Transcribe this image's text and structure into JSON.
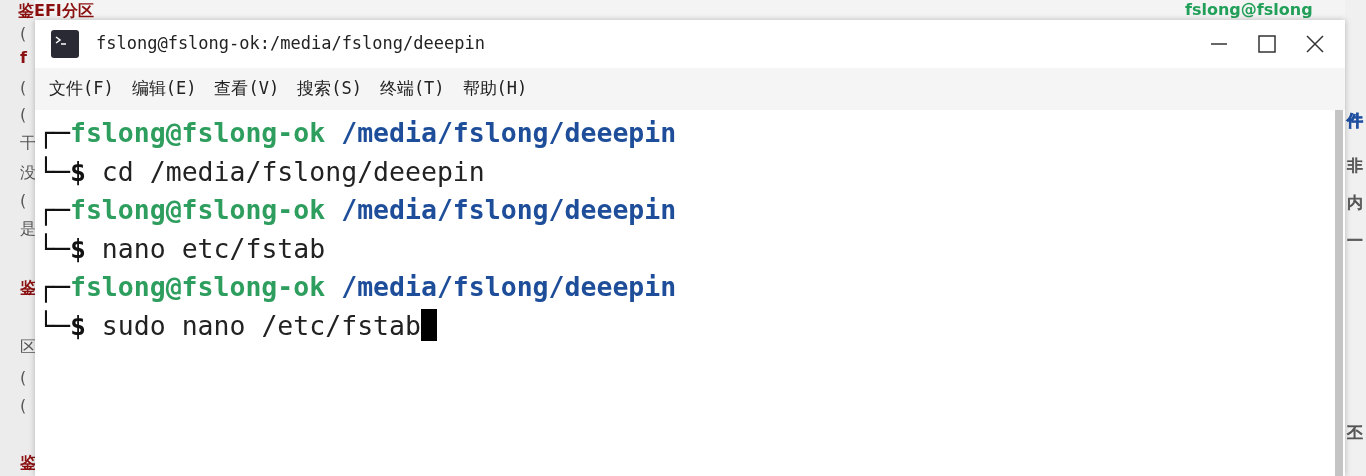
{
  "background": {
    "left_fragments": [
      {
        "text": "鉴EFI分区",
        "color": "#8b1010"
      },
      {
        "text": "(",
        "color": "#555555"
      },
      {
        "text": "f",
        "color": "#8b1010"
      },
      {
        "text": "(",
        "color": "#555555"
      },
      {
        "text": "(",
        "color": "#555555"
      },
      {
        "text": "干",
        "color": "#555555"
      },
      {
        "text": "没",
        "color": "#555555"
      },
      {
        "text": "(",
        "color": "#555555"
      },
      {
        "text": "是",
        "color": "#555555"
      },
      {
        "text": "鉴",
        "color": "#8b1010"
      },
      {
        "text": "区",
        "color": "#555555"
      },
      {
        "text": "(",
        "color": "#555555"
      },
      {
        "text": "(",
        "color": "#555555"
      },
      {
        "text": "鉴",
        "color": "#8b1010"
      }
    ],
    "right_fragments": [
      {
        "text": "fslong@fslong",
        "color": "#22a05a"
      },
      {
        "text": "件",
        "color": "#1f4fa0"
      },
      {
        "text": "非",
        "color": "#555555"
      },
      {
        "text": "内",
        "color": "#555555"
      },
      {
        "text": "一",
        "color": "#555555"
      },
      {
        "text": "丕",
        "color": "#555555"
      }
    ]
  },
  "window": {
    "title": "fslong@fslong-ok:/media/fslong/deeepin",
    "menu": [
      "文件(F)",
      "编辑(E)",
      "查看(V)",
      "搜索(S)",
      "终端(T)",
      "帮助(H)"
    ],
    "terminal": {
      "lines": [
        {
          "kind": "prompt",
          "corner": "┌─",
          "user_host": "fslong@fslong-ok",
          "path": "/media/fslong/deeepin"
        },
        {
          "kind": "command",
          "corner": "└─",
          "prompt": "$",
          "command": "cd /media/fslong/deeepin",
          "cursor": false
        },
        {
          "kind": "prompt",
          "corner": "┌─",
          "user_host": "fslong@fslong-ok",
          "path": "/media/fslong/deeepin"
        },
        {
          "kind": "command",
          "corner": "└─",
          "prompt": "$",
          "command": "nano etc/fstab",
          "cursor": false
        },
        {
          "kind": "prompt",
          "corner": "┌─",
          "user_host": "fslong@fslong-ok",
          "path": "/media/fslong/deeepin"
        },
        {
          "kind": "command",
          "corner": "└─",
          "prompt": "$",
          "command": "sudo nano /etc/fstab",
          "cursor": true
        }
      ]
    }
  }
}
